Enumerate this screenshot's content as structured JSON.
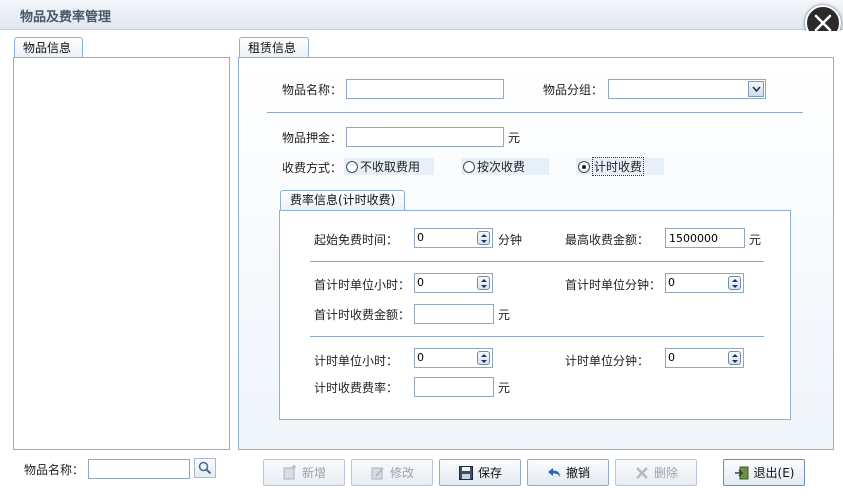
{
  "window": {
    "title": "物品及费率管理"
  },
  "tabs": {
    "left": "物品信息",
    "right": "租赁信息"
  },
  "item_name": {
    "label": "物品名称：",
    "value": ""
  },
  "item_group": {
    "label": "物品分组：",
    "value": ""
  },
  "deposit": {
    "label": "物品押金：",
    "value": "",
    "unit": "元"
  },
  "charge_method": {
    "label": "收费方式：",
    "options": [
      "不收取费用",
      "按次收费",
      "计时收费"
    ],
    "selected": "计时收费"
  },
  "rate_info": {
    "title": "费率信息(计时收费)",
    "free_start": {
      "label": "起始免费时间：",
      "value": "0",
      "unit": "分钟"
    },
    "max_fee": {
      "label": "最高收费金额：",
      "value": "1500000",
      "unit": "元"
    },
    "first_unit_hour": {
      "label": "首计时单位小时：",
      "value": "0"
    },
    "first_unit_min": {
      "label": "首计时单位分钟：",
      "value": "0"
    },
    "first_fee": {
      "label": "首计时收费金额：",
      "value": "",
      "unit": "元"
    },
    "unit_hour": {
      "label": "计时单位小时：",
      "value": "0"
    },
    "unit_min": {
      "label": "计时单位分钟：",
      "value": "0"
    },
    "rate": {
      "label": "计时收费费率：",
      "value": "",
      "unit": "元"
    }
  },
  "search": {
    "label": "物品名称：",
    "value": ""
  },
  "buttons": {
    "add": "新增",
    "edit": "修改",
    "save": "保存",
    "undo": "撤销",
    "delete": "删除",
    "exit": "退出(E)"
  },
  "colors": {
    "panel_border": "#8fb0d2",
    "selection_bg": "#e7eff8"
  }
}
